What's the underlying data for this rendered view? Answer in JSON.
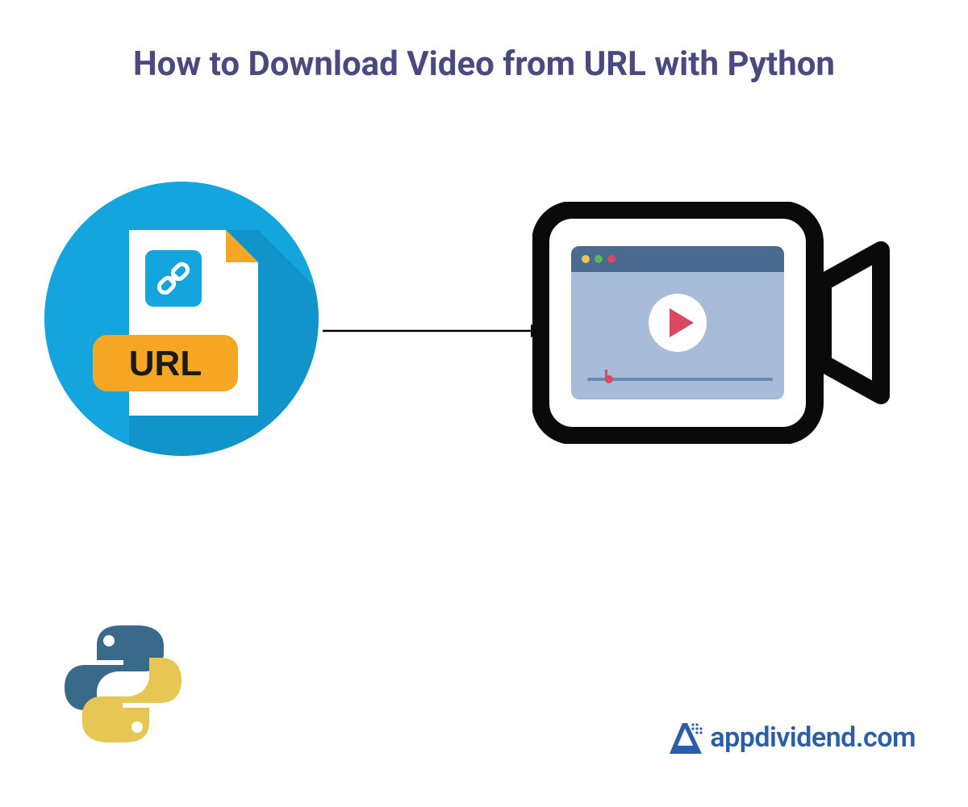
{
  "title": "How to Download Video from URL with Python",
  "url_label": "URL",
  "brand": "appdividend.com",
  "colors": {
    "title": "#4a4a80",
    "circle_main": "#14a4de",
    "circle_shadow": "#0e87b8",
    "file_bg": "#ffffff",
    "file_fold": "#f5a623",
    "link_box": "#14a4de",
    "url_badge": "#f5a623",
    "camera_outline": "#0a0a0a",
    "browser_bar": "#4a6a8f",
    "browser_body": "#a8bcda",
    "play_triangle": "#d94a60",
    "progress_track": "#6a8ab0",
    "progress_handle": "#d94a60",
    "python_blue": "#3a6a8a",
    "python_yellow": "#e8c654",
    "brand_blue": "#2a5fa8"
  }
}
